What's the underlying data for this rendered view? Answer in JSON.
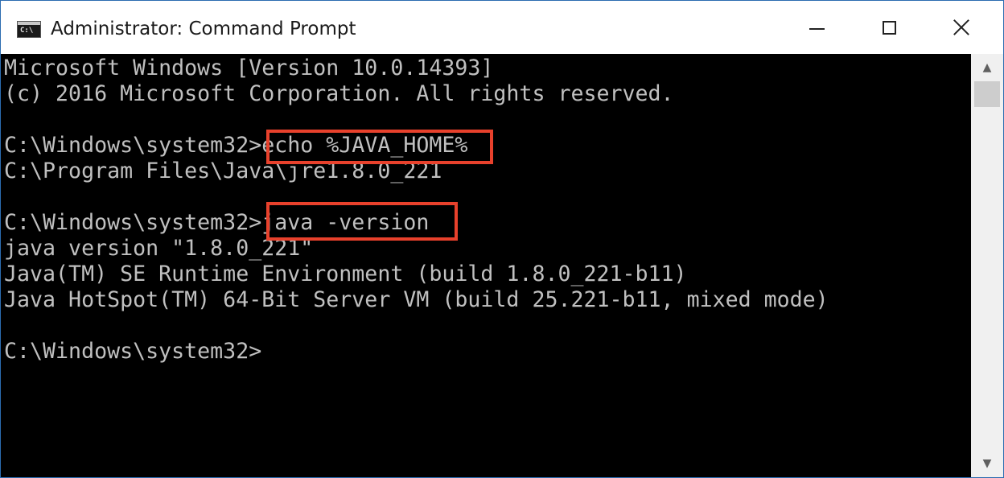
{
  "window": {
    "title": "Administrator: Command Prompt",
    "icon_label": "C:\\",
    "app_icon": "console-icon",
    "controls": {
      "minimize_icon": "minimize-icon",
      "maximize_icon": "maximize-icon",
      "close_icon": "close-icon"
    }
  },
  "console": {
    "lines": [
      "Microsoft Windows [Version 10.0.14393]",
      "(c) 2016 Microsoft Corporation. All rights reserved.",
      "",
      "C:\\Windows\\system32>echo %JAVA_HOME%",
      "C:\\Program Files\\Java\\jre1.8.0_221",
      "",
      "C:\\Windows\\system32>java -version",
      "java version \"1.8.0_221\"",
      "Java(TM) SE Runtime Environment (build 1.8.0_221-b11)",
      "Java HotSpot(TM) 64-Bit Server VM (build 25.221-b11, mixed mode)",
      "",
      "C:\\Windows\\system32>"
    ],
    "highlighted_commands": [
      "echo %JAVA_HOME%",
      "java -version"
    ],
    "text_color": "#c0c0c0",
    "background_color": "#000000",
    "highlight_color": "#e8412c"
  },
  "scrollbar": {
    "up_icon": "scroll-up-arrow-icon",
    "down_icon": "scroll-down-arrow-icon",
    "up_glyph": "▲",
    "down_glyph": "▼"
  }
}
